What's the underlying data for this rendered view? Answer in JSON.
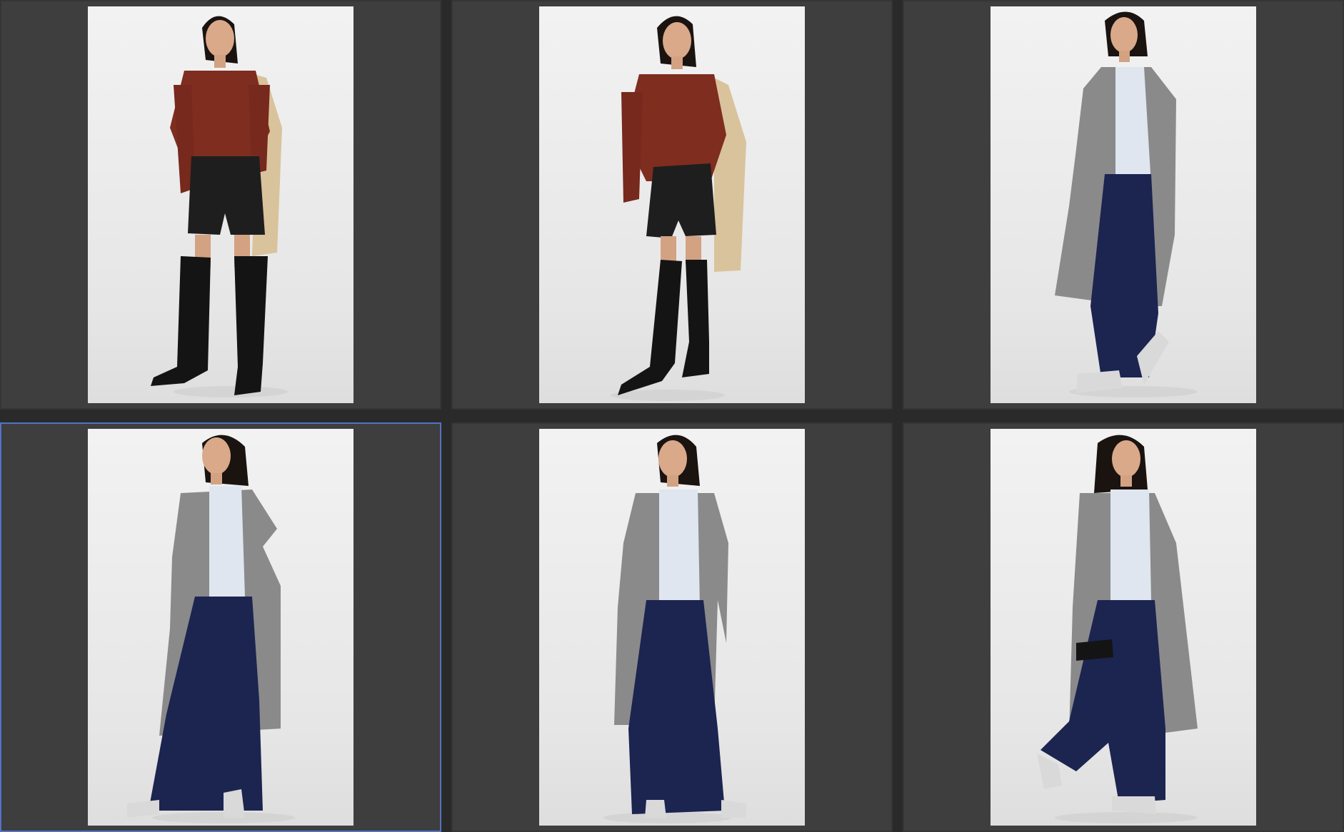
{
  "grid": {
    "thumbnails": [
      {
        "outfit": "rust-blouse-leather-shorts",
        "selected": false
      },
      {
        "outfit": "rust-blouse-leather-shorts",
        "selected": false
      },
      {
        "outfit": "grey-cardigan-navy-trousers",
        "selected": false
      },
      {
        "outfit": "grey-cardigan-navy-trousers",
        "selected": true
      },
      {
        "outfit": "grey-cardigan-navy-trousers",
        "selected": false
      },
      {
        "outfit": "grey-cardigan-navy-trousers",
        "selected": false
      }
    ]
  },
  "colors": {
    "panel": "#3e3e3e",
    "gutter": "#2a2a2a",
    "selection": "#5472c4",
    "blouse": "#7e2d1f",
    "shorts": "#1e1e1e",
    "boots": "#141414",
    "cardigan": "#8a8a8a",
    "coat": "#d9c39c",
    "shirt": "#dfe6ef",
    "trousers": "#1c2450"
  }
}
